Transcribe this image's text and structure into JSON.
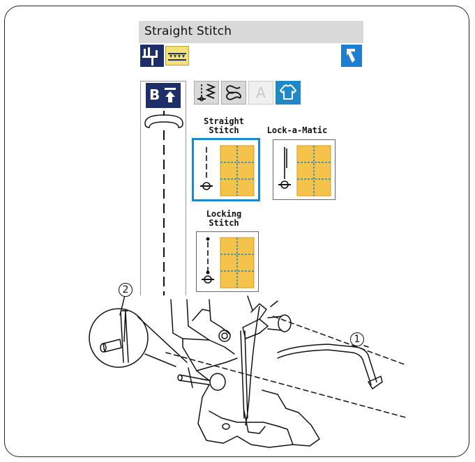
{
  "screen": {
    "title": "Straight Stitch",
    "toolbar": {
      "presser_foot_icon": "presser-foot-icon",
      "feed_dog_icon": "feed-dog-icon",
      "back_icon": "back-arrow-icon"
    },
    "side_panel": {
      "badge": "B",
      "badge_icon": "needle-up-down-icon"
    },
    "category_tabs": [
      {
        "icon": "utility-stitch-icon",
        "state": "normal"
      },
      {
        "icon": "decorative-stitch-icon",
        "state": "normal"
      },
      {
        "icon": "A",
        "state": "disabled"
      },
      {
        "icon": "garment-icon",
        "state": "active"
      }
    ],
    "patterns": [
      {
        "label_line1": "Straight",
        "label_line2": "Stitch",
        "selected": true
      },
      {
        "label_line1": "",
        "label_line2": "Lock-a-Matic",
        "selected": false
      },
      {
        "label_line1": "Locking",
        "label_line2": "Stitch",
        "selected": false
      }
    ]
  },
  "callouts": {
    "one": "1",
    "two": "2"
  },
  "colors": {
    "accent": "#1e88c8",
    "tab_bg": "#d9d9d9",
    "quilt_fill": "#f5c24a",
    "feed_dog_fill": "#f3e27a"
  }
}
